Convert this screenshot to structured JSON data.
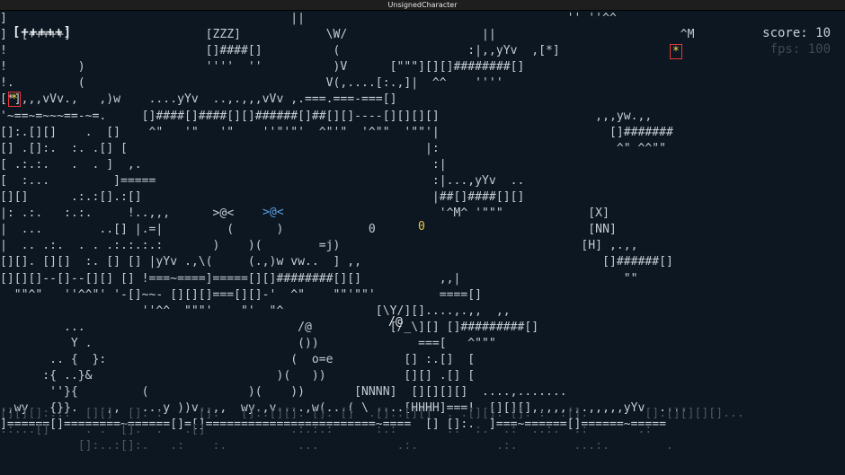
{
  "window": {
    "title": "UnsignedCharacter"
  },
  "hud": {
    "health": "[+++++]",
    "score_text": "score: 10",
    "fps_text": "fps: 100"
  },
  "map_lines": [
    "]                                        ||                                     '' ''^^ ",
    "]  [+++++]                   [ZZZ]            \\W/                   ||                          ^M",
    "!                            []####[]          (                  :|,,yYv  ,[*]           ",
    "!          )                 ''''  ''          )V      [\"\"\"][][]########[]             ",
    "!.         (                                  V(,....[:.,]|  ^^    ''''              ",
    "[*],,,vVv.,   ,)w    ....yYv  ..,.,,,vVv ,.===.===-===[]                         ",
    "'~==~=~~~==-~=.     []####[]####[][]######[]##[][]----[][][][]                      ,,,yw.,,",
    "[]:.[][]    .  []    ^\"   '\"   '\"    ''\"'\"'  ^\"'\"  '^\"\"  '\"\"'|                        []#######",
    "[] .[]:.  :. .[] [                                          |:                         ^\" ^^\"\"",
    "[ .:.:.   .  . ]  ,.                                         :|                               ",
    "[  :...         ]=====                                       :|...,yYv  ..                   ",
    "[][]      .:.:[].:[]                                         |##[]####[][]                  ",
    "|: .:.   :.:.     !..,,,      >@<                             '^M^ '\"\"\"            [X]",
    "|  ...        ..[] |.=|         (      )            0                              [NN]",
    "|  .. .:.  . . .:.:.:.:       )    )(        =j)                                  [H] ,.,,",
    "[][]. [][]  :. [] [] |yYv .,\\(     (.,)w vw..  ] ,,                                  []######[]",
    "[][][]--[]--[][] [] !===~====]=====[][]########[][]           ,,|                       \"\" ",
    "  \"\"^\"   ''^^\"' '-[]~~- [][][]===[][]-'  ^\"    \"\"'\"\"'         ====[]",
    "                    ''^^  \"\"\"'    \"'  \"^             [\\Y/][]....,.,,  ,,",
    "         ...                              /@           [/_\\][] []#########[]",
    "          Y .                             ())              ===[   ^\"\"\"",
    "       .. {  }:                          (  o=e          [] :.[]  [",
    "      :{ ..}&                          )(   ))           [][] .[] [",
    "       ''}{         (              )(    ))       [NNNN]  [][][][]  ....,.......",
    ".,wy   {}}.    ,,   ...y ))v.,,,  wy.,v....,w(...( \\ ....[HHHH]===!  [][][],,,,,.,.,,,,,yYv  ....",
    "]======[]========~======[]=[]========================~====  [] []:.  ]===~======[]======~====="
  ],
  "ground_lines": [
    "[][][]:...  [][]  []. :     [].   []:.[][]. []. []  .[]..[][]  . .[][]. []. :  .[].        [].[][][][]...",
    ".:...[]     . .  [].  .   .[]            .:.:.:      :.:       ..  :.  .:  ..:.  .:       .:",
    "           []:..:[]:.   .:    :.          ...           .:.           .:.        ...:.        ."
  ]
}
